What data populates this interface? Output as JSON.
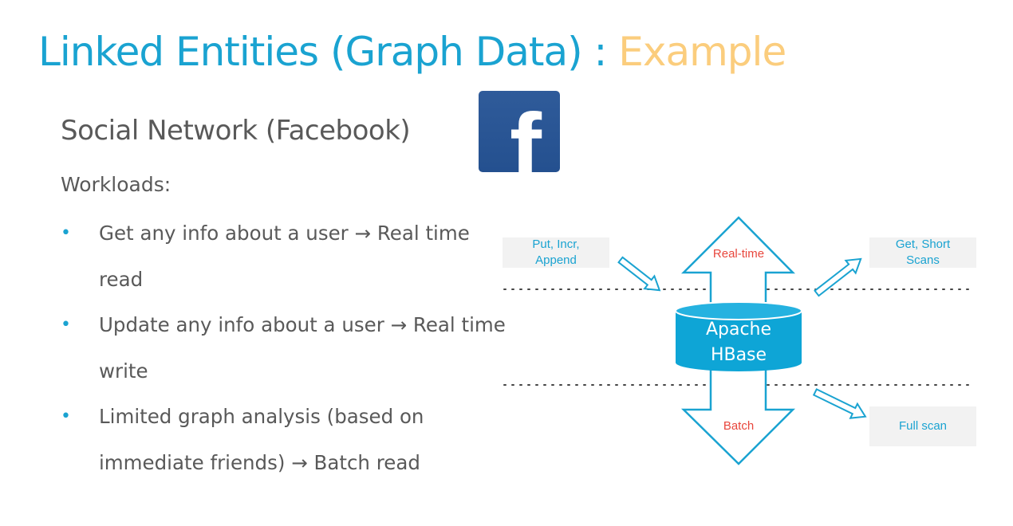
{
  "title": {
    "part1": "Linked Entities (Graph Data) : ",
    "part2": "Example"
  },
  "subtitle": "Social Network (Facebook)",
  "workloads_label": "Workloads:",
  "bullets": [
    "Get any info about a user → Real time read",
    "Update any info about a user → Real time write",
    "Limited graph analysis (based on immediate friends) → Batch read"
  ],
  "bullet_glyph": "•",
  "logo": {
    "icon": "facebook-logo-icon",
    "letter": "f"
  },
  "diagram": {
    "input_box": {
      "line1": "Put, Incr,",
      "line2": "Append"
    },
    "output_box": {
      "line1": "Get, Short",
      "line2": "Scans"
    },
    "scan_box": "Full scan",
    "realtime_label": "Real-time",
    "batch_label": "Batch",
    "database": {
      "line1": "Apache",
      "line2": "HBase"
    }
  },
  "colors": {
    "accent_blue": "#1aa3d1",
    "accent_orange": "#fbcd7d",
    "text_gray": "#595959",
    "label_red": "#e8463c",
    "box_gray": "#f2f2f2",
    "facebook_blue": "#2f5b9a"
  }
}
